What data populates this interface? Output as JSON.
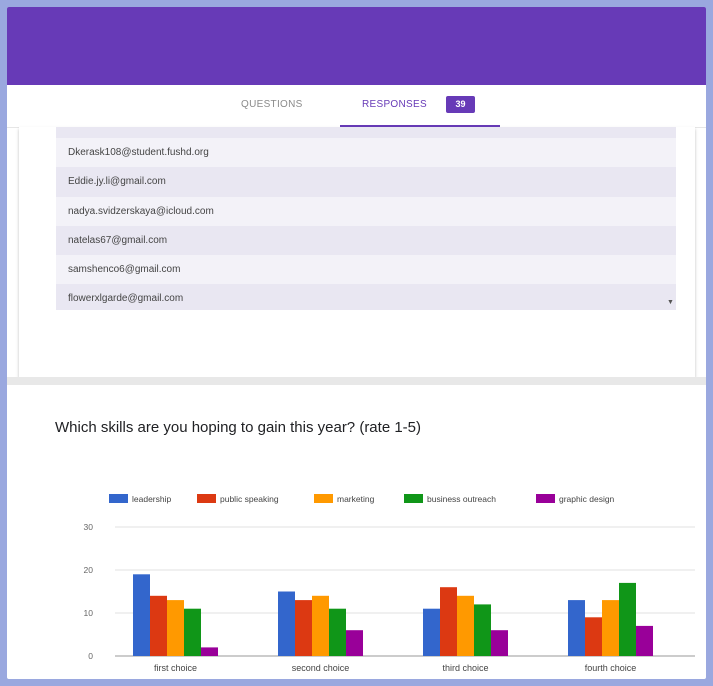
{
  "tabs": {
    "questions_label": "QUESTIONS",
    "responses_label": "RESPONSES",
    "responses_count": "39"
  },
  "responses_list": {
    "emails": [
      "Dkerask108@student.fushd.org",
      "Eddie.jy.li@gmail.com",
      "nadya.svidzerskaya@icloud.com",
      "natelas67@gmail.com",
      "samshenco6@gmail.com",
      "flowerxlgarde@gmail.com"
    ]
  },
  "question": {
    "title": "Which skills are you hoping to gain this year? (rate 1-5)"
  },
  "colors": {
    "header": "#673ab7",
    "leadership": "#3366cc",
    "public_speaking": "#dc3912",
    "marketing": "#ff9900",
    "business_outreach": "#109618",
    "graphic_design": "#990099"
  },
  "chart_data": {
    "type": "bar",
    "categories": [
      "first choice",
      "second choice",
      "third choice",
      "fourth choice"
    ],
    "series": [
      {
        "name": "leadership",
        "values": [
          19,
          15,
          11,
          13
        ]
      },
      {
        "name": "public speaking",
        "values": [
          14,
          13,
          16,
          9
        ]
      },
      {
        "name": "marketing",
        "values": [
          13,
          14,
          14,
          13
        ]
      },
      {
        "name": "business outreach",
        "values": [
          11,
          11,
          12,
          17
        ]
      },
      {
        "name": "graphic design",
        "values": [
          2,
          6,
          6,
          7
        ]
      }
    ],
    "yticks": [
      "0",
      "10",
      "20",
      "30"
    ],
    "ylim": [
      0,
      30
    ],
    "legend_position": "top",
    "grid": true
  }
}
